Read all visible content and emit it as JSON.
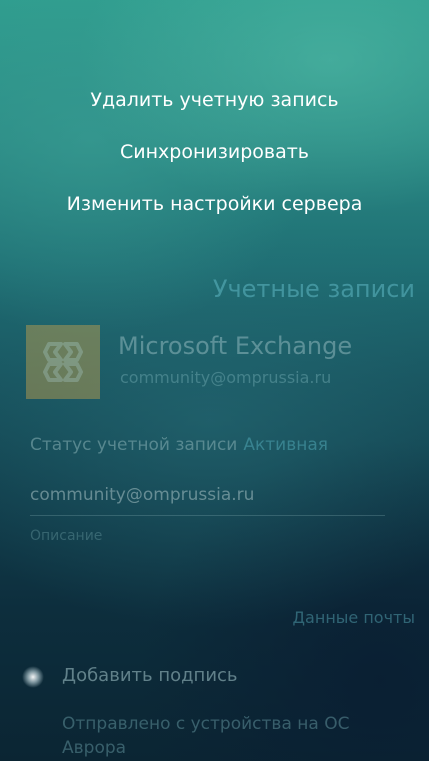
{
  "pulley_menu": {
    "items": [
      {
        "label": "Удалить учетную запись"
      },
      {
        "label": "Синхронизировать"
      },
      {
        "label": "Изменить настройки сервера"
      }
    ]
  },
  "accounts_section": {
    "header": "Учетные записи"
  },
  "account": {
    "name": "Microsoft Exchange",
    "email": "community@omprussia.ru",
    "icon": "exchange-icon"
  },
  "status": {
    "label": "Статус учетной записи",
    "value": "Активная"
  },
  "email_field": {
    "value": "community@omprussia.ru"
  },
  "description_field": {
    "placeholder": "Описание"
  },
  "mail_data_section": {
    "header": "Данные почты"
  },
  "signature": {
    "switch_label": "Добавить подпись",
    "text": "Отправлено с устройства на ОС Аврора"
  },
  "colors": {
    "accent": "#4fa6b4",
    "icon_bg": "#c7a34e"
  }
}
